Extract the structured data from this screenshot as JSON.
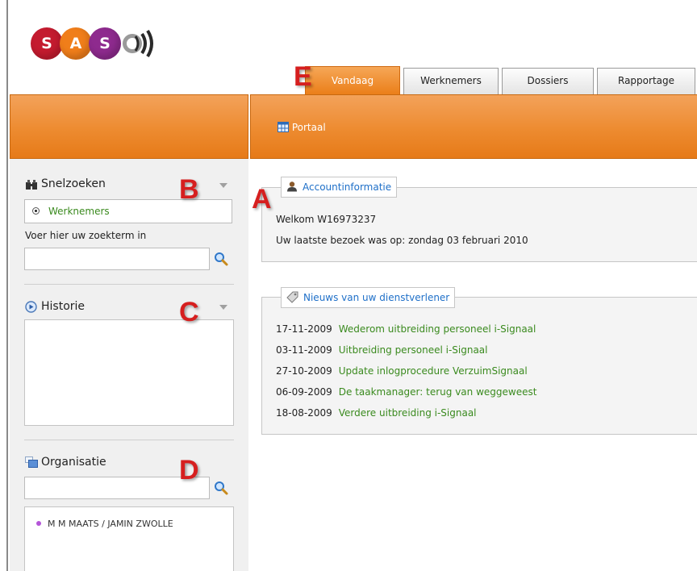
{
  "logo": {
    "letters": [
      "S",
      "A",
      "S"
    ],
    "colors": [
      "#c41b2f",
      "#f07e1a",
      "#8e2a8e"
    ]
  },
  "tabs": [
    {
      "label": "Vandaag",
      "active": true
    },
    {
      "label": "Werknemers",
      "active": false
    },
    {
      "label": "Dossiers",
      "active": false
    },
    {
      "label": "Rapportage",
      "active": false
    }
  ],
  "toolbar": {
    "portaal_label": "Portaal"
  },
  "snelzoeken": {
    "title": "Snelzoeken",
    "radio_label": "Werknemers",
    "search_label": "Voer hier uw zoekterm in",
    "search_value": ""
  },
  "historie": {
    "title": "Historie"
  },
  "organisatie": {
    "title": "Organisatie",
    "search_value": "",
    "items": [
      "M M MAATS / JAMIN ZWOLLE"
    ]
  },
  "account": {
    "title": "Accountinformatie",
    "welcome": "Welkom W16973237",
    "last_visit": "Uw laatste bezoek was op: zondag 03 februari 2010"
  },
  "news": {
    "title": "Nieuws van uw dienstverlener",
    "items": [
      {
        "date": "17-11-2009",
        "text": "Wederom uitbreiding personeel i-Signaal"
      },
      {
        "date": "03-11-2009",
        "text": "Uitbreiding personeel i-Signaal"
      },
      {
        "date": "27-10-2009",
        "text": "Update inlogprocedure VerzuimSignaal"
      },
      {
        "date": "06-09-2009",
        "text": "De taakmanager: terug van weggeweest"
      },
      {
        "date": "18-08-2009",
        "text": "Verdere uitbreiding i-Signaal"
      }
    ]
  },
  "annotations": {
    "a": "A",
    "b": "B",
    "c": "C",
    "d": "D",
    "e": "E"
  },
  "colors": {
    "accent_orange": "#ed8b30",
    "link_green": "#3a8a1e",
    "link_blue": "#1e6fc8",
    "annotation_red": "#d61f1f"
  }
}
